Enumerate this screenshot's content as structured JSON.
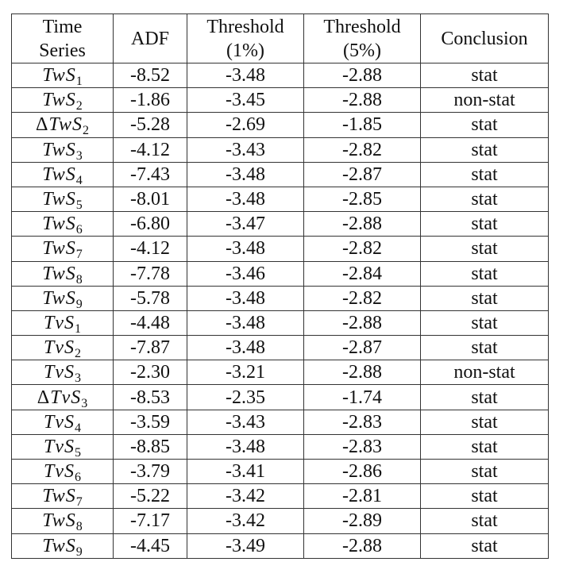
{
  "table": {
    "headers": {
      "series_line1": "Time",
      "series_line2": "Series",
      "adf": "ADF",
      "t1_line1": "Threshold",
      "t1_line2": "(1%)",
      "t5_line1": "Threshold",
      "t5_line2": "(5%)",
      "conclusion": "Conclusion"
    },
    "rows": [
      {
        "delta": "",
        "name": "TwS",
        "sub": "1",
        "adf": "-8.52",
        "t1": "-3.48",
        "t5": "-2.88",
        "conclusion": "stat"
      },
      {
        "delta": "",
        "name": "TwS",
        "sub": "2",
        "adf": "-1.86",
        "t1": "-3.45",
        "t5": "-2.88",
        "conclusion": "non-stat"
      },
      {
        "delta": "Δ",
        "name": "TwS",
        "sub": "2",
        "adf": "-5.28",
        "t1": "-2.69",
        "t5": "-1.85",
        "conclusion": "stat"
      },
      {
        "delta": "",
        "name": "TwS",
        "sub": "3",
        "adf": "-4.12",
        "t1": "-3.43",
        "t5": "-2.82",
        "conclusion": "stat"
      },
      {
        "delta": "",
        "name": "TwS",
        "sub": "4",
        "adf": "-7.43",
        "t1": "-3.48",
        "t5": "-2.87",
        "conclusion": "stat"
      },
      {
        "delta": "",
        "name": "TwS",
        "sub": "5",
        "adf": "-8.01",
        "t1": "-3.48",
        "t5": "-2.85",
        "conclusion": "stat"
      },
      {
        "delta": "",
        "name": "TwS",
        "sub": "6",
        "adf": "-6.80",
        "t1": "-3.47",
        "t5": "-2.88",
        "conclusion": "stat"
      },
      {
        "delta": "",
        "name": "TwS",
        "sub": "7",
        "adf": "-4.12",
        "t1": "-3.48",
        "t5": "-2.82",
        "conclusion": "stat"
      },
      {
        "delta": "",
        "name": "TwS",
        "sub": "8",
        "adf": "-7.78",
        "t1": "-3.46",
        "t5": "-2.84",
        "conclusion": "stat"
      },
      {
        "delta": "",
        "name": "TwS",
        "sub": "9",
        "adf": "-5.78",
        "t1": "-3.48",
        "t5": "-2.82",
        "conclusion": "stat"
      },
      {
        "delta": "",
        "name": "TvS",
        "sub": "1",
        "adf": "-4.48",
        "t1": "-3.48",
        "t5": "-2.88",
        "conclusion": "stat"
      },
      {
        "delta": "",
        "name": "TvS",
        "sub": "2",
        "adf": "-7.87",
        "t1": "-3.48",
        "t5": "-2.87",
        "conclusion": "stat"
      },
      {
        "delta": "",
        "name": "TvS",
        "sub": "3",
        "adf": "-2.30",
        "t1": "-3.21",
        "t5": "-2.88",
        "conclusion": "non-stat"
      },
      {
        "delta": "Δ",
        "name": "TvS",
        "sub": "3",
        "adf": "-8.53",
        "t1": "-2.35",
        "t5": "-1.74",
        "conclusion": "stat"
      },
      {
        "delta": "",
        "name": "TvS",
        "sub": "4",
        "adf": "-3.59",
        "t1": "-3.43",
        "t5": "-2.83",
        "conclusion": "stat"
      },
      {
        "delta": "",
        "name": "TvS",
        "sub": "5",
        "adf": "-8.85",
        "t1": "-3.48",
        "t5": "-2.83",
        "conclusion": "stat"
      },
      {
        "delta": "",
        "name": "TvS",
        "sub": "6",
        "adf": "-3.79",
        "t1": "-3.41",
        "t5": "-2.86",
        "conclusion": "stat"
      },
      {
        "delta": "",
        "name": "TwS",
        "sub": "7",
        "adf": "-5.22",
        "t1": "-3.42",
        "t5": "-2.81",
        "conclusion": "stat"
      },
      {
        "delta": "",
        "name": "TwS",
        "sub": "8",
        "adf": "-7.17",
        "t1": "-3.42",
        "t5": "-2.89",
        "conclusion": "stat"
      },
      {
        "delta": "",
        "name": "TwS",
        "sub": "9",
        "adf": "-4.45",
        "t1": "-3.49",
        "t5": "-2.88",
        "conclusion": "stat"
      }
    ]
  }
}
